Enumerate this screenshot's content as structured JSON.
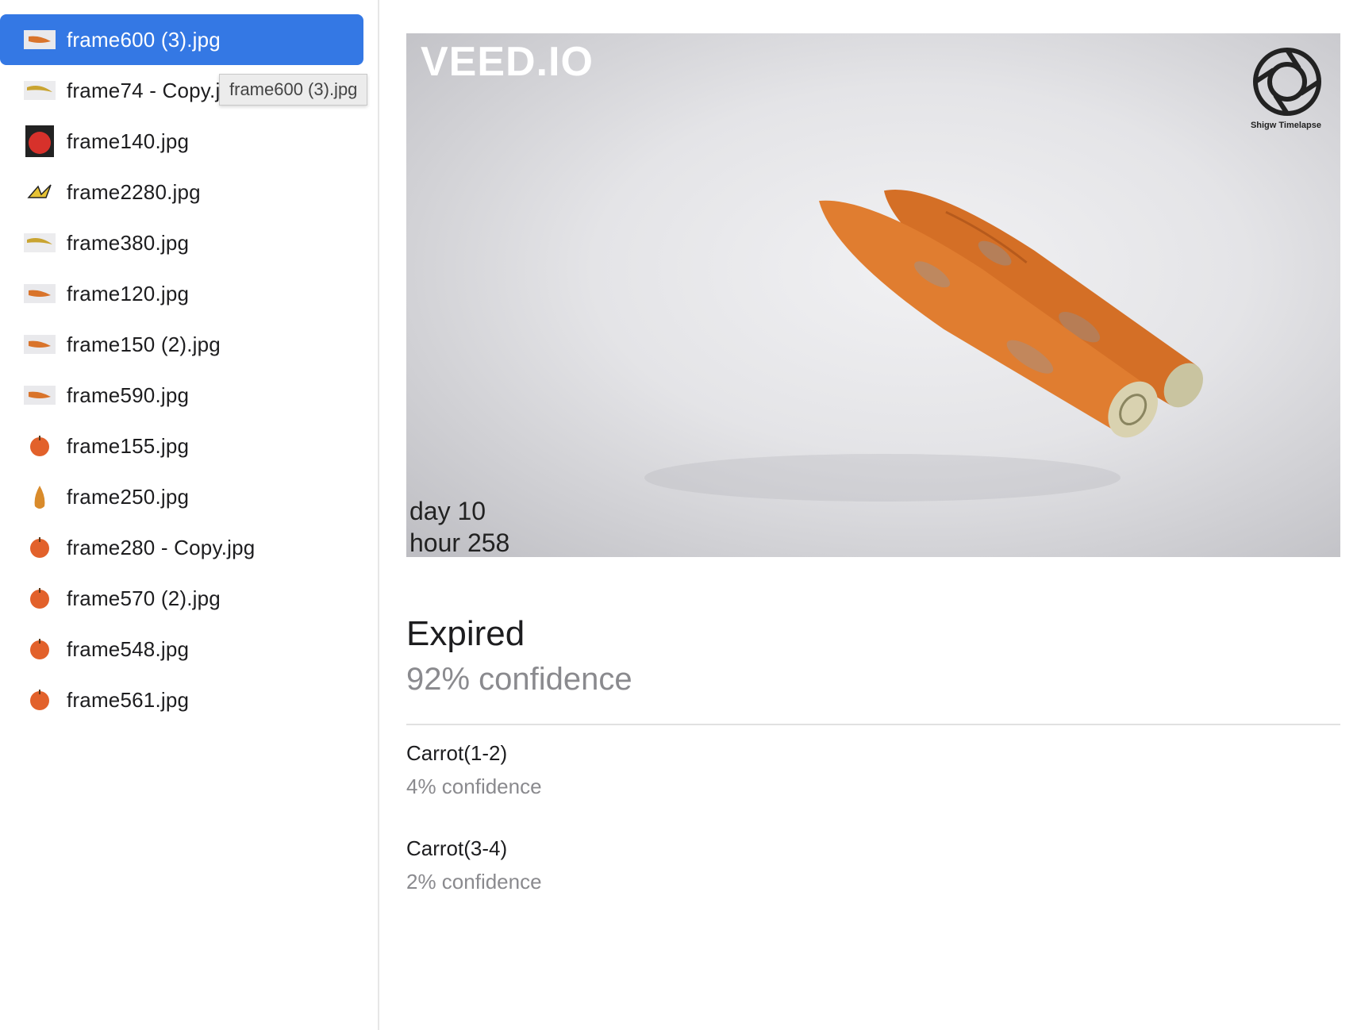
{
  "sidebar": {
    "files": [
      {
        "name": "frame600 (3).jpg",
        "thumb": "carrot-icon",
        "selected": true
      },
      {
        "name": "frame74 - Copy.jpg",
        "thumb": "banana-icon",
        "selected": false
      },
      {
        "name": "frame140.jpg",
        "thumb": "tomato-icon",
        "selected": false
      },
      {
        "name": "frame2280.jpg",
        "thumb": "banana-peel-icon",
        "selected": false
      },
      {
        "name": "frame380.jpg",
        "thumb": "banana-icon",
        "selected": false
      },
      {
        "name": "frame120.jpg",
        "thumb": "carrot-icon",
        "selected": false
      },
      {
        "name": "frame150 (2).jpg",
        "thumb": "carrot-icon",
        "selected": false
      },
      {
        "name": "frame590.jpg",
        "thumb": "carrot-icon",
        "selected": false
      },
      {
        "name": "frame155.jpg",
        "thumb": "apple-icon",
        "selected": false
      },
      {
        "name": "frame250.jpg",
        "thumb": "pear-icon",
        "selected": false
      },
      {
        "name": "frame280 - Copy.jpg",
        "thumb": "apple-icon",
        "selected": false
      },
      {
        "name": "frame570 (2).jpg",
        "thumb": "apple-icon",
        "selected": false
      },
      {
        "name": "frame548.jpg",
        "thumb": "apple-icon",
        "selected": false
      },
      {
        "name": "frame561.jpg",
        "thumb": "apple-icon",
        "selected": false
      }
    ],
    "tooltip": "frame600 (3).jpg"
  },
  "preview": {
    "watermark": "VEED.IO",
    "logo_text": "Shigw Timelapse",
    "day_text": "day  10",
    "hour_text": "hour 258"
  },
  "result": {
    "top_label": "Expired",
    "top_confidence": "92% confidence",
    "alternatives": [
      {
        "label": "Carrot(1-2)",
        "confidence": "4% confidence"
      },
      {
        "label": "Carrot(3-4)",
        "confidence": "2% confidence"
      }
    ]
  },
  "colors": {
    "selection": "#3478e4",
    "secondary_text": "#8a8a8e",
    "carrot": "#d9742b"
  }
}
